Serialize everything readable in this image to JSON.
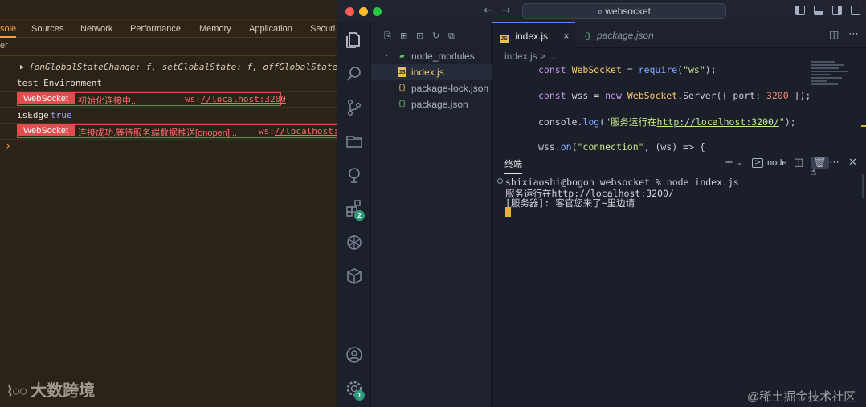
{
  "devtools": {
    "tabs": [
      {
        "label": "sole",
        "active": true
      },
      {
        "label": "Sources"
      },
      {
        "label": "Network"
      },
      {
        "label": "Performance"
      },
      {
        "label": "Memory"
      },
      {
        "label": "Application"
      },
      {
        "label": "Securi"
      }
    ],
    "filter_text": "er",
    "console": {
      "object_preview": "{onGlobalStateChange: f, setGlobalState: f, offGlobalStateChange: f",
      "env_line": "test Environment",
      "ws_tag": "WebSocket",
      "row1_message": "初始化连接中...",
      "row1_url_prefix": "ws:",
      "row1_url": "//localhost:3200",
      "isedge_label": "isEdge",
      "isedge_value": "true",
      "row2_message": "连接成功,等待服务端数据推送[onopen]...",
      "row2_url_prefix": "ws:",
      "row2_url": "//localhost:3.",
      "prompt_glyph": "›"
    },
    "watermark": "大数跨境"
  },
  "vscode": {
    "title_search": "websocket",
    "explorer": {
      "files": [
        {
          "name": "node_modules",
          "type": "folder"
        },
        {
          "name": "index.js",
          "type": "js",
          "active": true
        },
        {
          "name": "package-lock.json",
          "type": "json"
        },
        {
          "name": "package.json",
          "type": "json"
        }
      ]
    },
    "editor": {
      "tabs": [
        {
          "label": "index.js",
          "icon": "JS",
          "active": true,
          "close": "×"
        },
        {
          "label": "package.json",
          "icon": "{}",
          "active": false
        }
      ],
      "breadcrumb": "index.js > ...",
      "code": [
        {
          "kw": "const",
          "name": "WebSocket",
          "op": " = ",
          "fn": "require",
          "rest_open": "(",
          "str": "\"ws\"",
          "rest_close": ");"
        },
        {
          "kw": "const",
          "name": "wss",
          "op": " = ",
          "kw2": "new",
          "cls": "WebSocket",
          "rest": ".Server({ port: ",
          "num": "3200",
          "end": " });"
        },
        {
          "pre": "console.",
          "fn": "log",
          "open": "(",
          "str1": "\"服务运行在",
          "url": "http://localhost:3200/",
          "str2": "\"",
          "end": ");"
        },
        {
          "pre": "wss.",
          "fn": "on",
          "open": "(",
          "str": "\"connection\"",
          "rest": ", (ws) => {"
        }
      ]
    },
    "terminal": {
      "tab_label": "终端",
      "shell_label": "node",
      "lines": [
        "shixiaoshi@bogon websocket % node index.js",
        "服务运行在http://localhost:3200/",
        "[服务器]: 客官您来了~里边请"
      ]
    },
    "activity_badges": {
      "extensions": "2",
      "settings": "1"
    },
    "colors": {
      "accent": "#4d8ef7",
      "ws_tag": "#e34c4c",
      "terminal_cursor": "#e3b23c"
    }
  },
  "watermark_right": "@稀土掘金技术社区"
}
